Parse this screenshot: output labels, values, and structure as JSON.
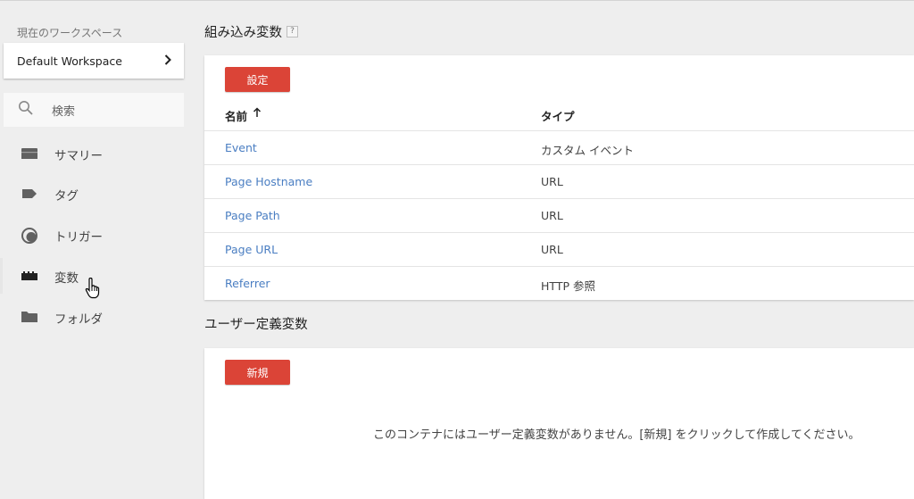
{
  "sidebar": {
    "workspace_label": "現在のワークスペース",
    "workspace_name": "Default Workspace",
    "search_placeholder": "検索",
    "items": [
      {
        "label": "サマリー",
        "icon": "folder-open-icon"
      },
      {
        "label": "タグ",
        "icon": "tag-icon"
      },
      {
        "label": "トリガー",
        "icon": "trigger-icon"
      },
      {
        "label": "変数",
        "icon": "blocks-icon",
        "active": true
      },
      {
        "label": "フォルダ",
        "icon": "folder-icon"
      }
    ]
  },
  "builtin": {
    "title": "組み込み変数",
    "help": "?",
    "config_button": "設定",
    "columns": {
      "name": "名前",
      "type": "タイプ"
    },
    "rows": [
      {
        "name": "Event",
        "type": "カスタム イベント"
      },
      {
        "name": "Page Hostname",
        "type": "URL"
      },
      {
        "name": "Page Path",
        "type": "URL"
      },
      {
        "name": "Page URL",
        "type": "URL"
      },
      {
        "name": "Referrer",
        "type": "HTTP 参照"
      }
    ]
  },
  "user_defined": {
    "title": "ユーザー定義変数",
    "new_button": "新規",
    "empty_message": "このコンテナにはユーザー定義変数がありません。[新規] をクリックして作成してください。"
  },
  "colors": {
    "accent_red": "#db4437",
    "link_blue": "#4a7ec2",
    "background": "#eeeeee"
  }
}
